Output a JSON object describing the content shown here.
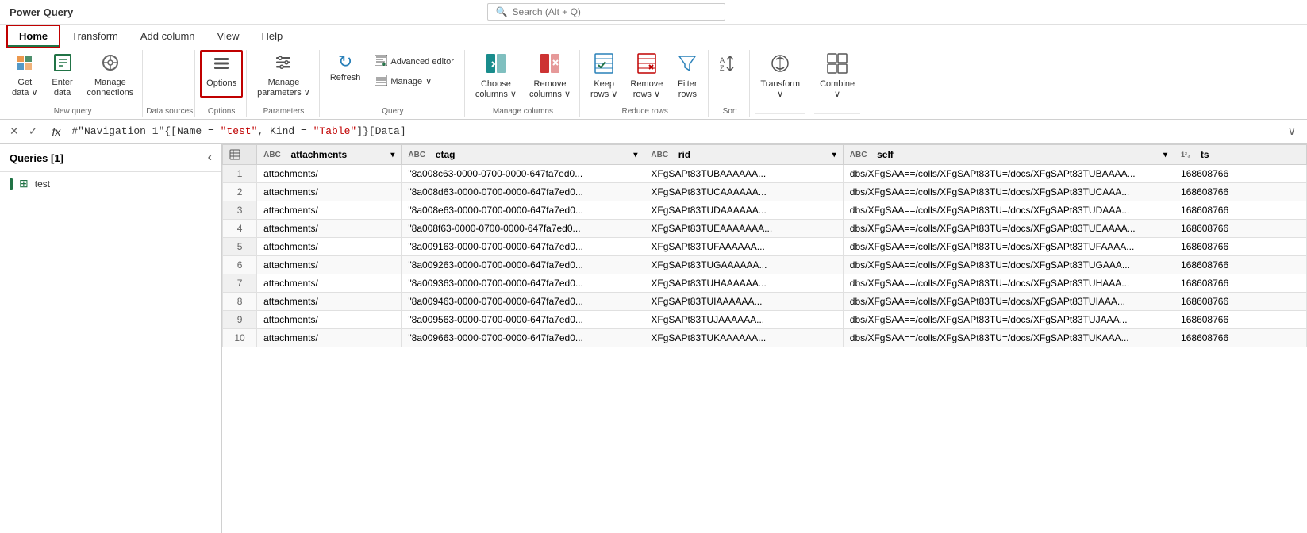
{
  "titleBar": {
    "appName": "Power Query",
    "searchPlaceholder": "Search (Alt + Q)"
  },
  "ribbon": {
    "tabs": [
      {
        "id": "home",
        "label": "Home",
        "active": true
      },
      {
        "id": "transform",
        "label": "Transform",
        "active": false
      },
      {
        "id": "addcolumn",
        "label": "Add column",
        "active": false
      },
      {
        "id": "view",
        "label": "View",
        "active": false
      },
      {
        "id": "help",
        "label": "Help",
        "active": false
      }
    ],
    "groups": [
      {
        "id": "new-query",
        "label": "New query",
        "buttons": [
          {
            "id": "get-data",
            "icon": "📥",
            "label": "Get\ndata ∨",
            "iconColor": "orange"
          },
          {
            "id": "enter-data",
            "icon": "⊞",
            "label": "Enter\ndata",
            "iconColor": "green"
          },
          {
            "id": "manage-connections",
            "icon": "⚙",
            "label": "Manage\nconnections",
            "iconColor": "gray"
          }
        ]
      },
      {
        "id": "data-sources",
        "label": "Data sources",
        "buttons": []
      },
      {
        "id": "options",
        "label": "Options",
        "highlighted": true,
        "buttons": [
          {
            "id": "options-btn",
            "icon": "☰",
            "label": "Options",
            "highlighted": true
          }
        ]
      },
      {
        "id": "parameters",
        "label": "Parameters",
        "buttons": [
          {
            "id": "manage-params",
            "icon": "≡",
            "label": "Manage\nparameters ∨"
          }
        ]
      },
      {
        "id": "query",
        "label": "Query",
        "buttons": [
          {
            "id": "refresh",
            "icon": "↻",
            "label": "Refresh",
            "iconColor": "blue"
          },
          {
            "id": "adv-editor",
            "icon": "✎",
            "label": "Advanced editor",
            "small": true
          },
          {
            "id": "manage",
            "icon": "☰",
            "label": "Manage",
            "small": true
          }
        ]
      },
      {
        "id": "manage-columns",
        "label": "Manage columns",
        "buttons": [
          {
            "id": "choose-columns",
            "icon": "▦",
            "label": "Choose\ncolumns ∨",
            "iconColor": "teal"
          },
          {
            "id": "remove-columns",
            "icon": "▤",
            "label": "Remove\ncolumns ∨",
            "iconColor": "red"
          }
        ]
      },
      {
        "id": "reduce-rows",
        "label": "Reduce rows",
        "buttons": [
          {
            "id": "keep-rows",
            "icon": "▤",
            "label": "Keep\nrows ∨",
            "iconColor": "blue"
          },
          {
            "id": "remove-rows",
            "icon": "▤✗",
            "label": "Remove\nrows ∨",
            "iconColor": "red"
          },
          {
            "id": "filter-rows",
            "icon": "▽",
            "label": "Filter\nrows",
            "iconColor": "blue"
          }
        ]
      },
      {
        "id": "sort",
        "label": "Sort",
        "buttons": [
          {
            "id": "sort-az",
            "icon": "↕AZ",
            "label": ""
          }
        ]
      },
      {
        "id": "transform-group",
        "label": "",
        "buttons": [
          {
            "id": "transform-btn",
            "icon": "⚡",
            "label": "Transform\n∨"
          }
        ]
      },
      {
        "id": "combine",
        "label": "",
        "buttons": [
          {
            "id": "combine-btn",
            "icon": "⊕",
            "label": "Combine\n∨"
          }
        ]
      }
    ]
  },
  "formulaBar": {
    "cancelText": "✕",
    "confirmText": "✓",
    "fxText": "fx",
    "formula": "#\"Navigation 1\"{[Name = \"test\", Kind = \"Table\"]}[Data]",
    "expandIcon": "∨"
  },
  "sidebar": {
    "title": "Queries [1]",
    "collapseIcon": "‹",
    "queries": [
      {
        "id": "test",
        "name": "test",
        "icon": "⊞",
        "color": "#217346"
      }
    ]
  },
  "grid": {
    "columns": [
      {
        "id": "rownum",
        "label": "#",
        "type": ""
      },
      {
        "id": "_attachments",
        "label": "_attachments",
        "type": "ABC"
      },
      {
        "id": "_etag",
        "label": "_etag",
        "type": "ABC"
      },
      {
        "id": "_rid",
        "label": "_rid",
        "type": "ABC"
      },
      {
        "id": "_self",
        "label": "_self",
        "type": "ABC"
      },
      {
        "id": "_ts",
        "label": "_ts",
        "type": "123"
      }
    ],
    "rows": [
      {
        "rownum": "1",
        "_attachments": "attachments/",
        "_etag": "\"8a008c63-0000-0700-0000-647fa7ed0...",
        "_rid": "XFgSAPt83TUBAAAAAA...",
        "_self": "dbs/XFgSAA==/colls/XFgSAPt83TU=/docs/XFgSAPt83TUBAAAA...",
        "_ts": "168608766"
      },
      {
        "rownum": "2",
        "_attachments": "attachments/",
        "_etag": "\"8a008d63-0000-0700-0000-647fa7ed0...",
        "_rid": "XFgSAPt83TUCAAAAAA...",
        "_self": "dbs/XFgSAA==/colls/XFgSAPt83TU=/docs/XFgSAPt83TUCAAA...",
        "_ts": "168608766"
      },
      {
        "rownum": "3",
        "_attachments": "attachments/",
        "_etag": "\"8a008e63-0000-0700-0000-647fa7ed0...",
        "_rid": "XFgSAPt83TUDAAAAAA...",
        "_self": "dbs/XFgSAA==/colls/XFgSAPt83TU=/docs/XFgSAPt83TUDAAA...",
        "_ts": "168608766"
      },
      {
        "rownum": "4",
        "_attachments": "attachments/",
        "_etag": "\"8a008f63-0000-0700-0000-647fa7ed0...",
        "_rid": "XFgSAPt83TUEAAAAAAA...",
        "_self": "dbs/XFgSAA==/colls/XFgSAPt83TU=/docs/XFgSAPt83TUEAAAA...",
        "_ts": "168608766"
      },
      {
        "rownum": "5",
        "_attachments": "attachments/",
        "_etag": "\"8a009163-0000-0700-0000-647fa7ed0...",
        "_rid": "XFgSAPt83TUFAAAAAA...",
        "_self": "dbs/XFgSAA==/colls/XFgSAPt83TU=/docs/XFgSAPt83TUFAAAA...",
        "_ts": "168608766"
      },
      {
        "rownum": "6",
        "_attachments": "attachments/",
        "_etag": "\"8a009263-0000-0700-0000-647fa7ed0...",
        "_rid": "XFgSAPt83TUGAAAAAA...",
        "_self": "dbs/XFgSAA==/colls/XFgSAPt83TU=/docs/XFgSAPt83TUGAAA...",
        "_ts": "168608766"
      },
      {
        "rownum": "7",
        "_attachments": "attachments/",
        "_etag": "\"8a009363-0000-0700-0000-647fa7ed0...",
        "_rid": "XFgSAPt83TUHAAAAAA...",
        "_self": "dbs/XFgSAA==/colls/XFgSAPt83TU=/docs/XFgSAPt83TUHAAA...",
        "_ts": "168608766"
      },
      {
        "rownum": "8",
        "_attachments": "attachments/",
        "_etag": "\"8a009463-0000-0700-0000-647fa7ed0...",
        "_rid": "XFgSAPt83TUIAAAAAA...",
        "_self": "dbs/XFgSAA==/colls/XFgSAPt83TU=/docs/XFgSAPt83TUIAAA...",
        "_ts": "168608766"
      },
      {
        "rownum": "9",
        "_attachments": "attachments/",
        "_etag": "\"8a009563-0000-0700-0000-647fa7ed0...",
        "_rid": "XFgSAPt83TUJAAAAAA...",
        "_self": "dbs/XFgSAA==/colls/XFgSAPt83TU=/docs/XFgSAPt83TUJAAA...",
        "_ts": "168608766"
      },
      {
        "rownum": "10",
        "_attachments": "attachments/",
        "_etag": "\"8a009663-0000-0700-0000-647fa7ed0...",
        "_rid": "XFgSAPt83TUKAAAAAA...",
        "_self": "dbs/XFgSAA==/colls/XFgSAPt83TU=/docs/XFgSAPt83TUKAAA...",
        "_ts": "168608766"
      }
    ]
  }
}
